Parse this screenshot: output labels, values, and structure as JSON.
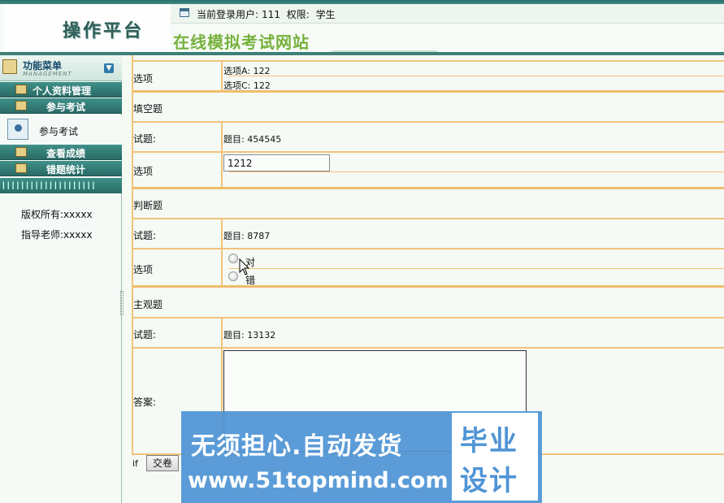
{
  "header": {
    "logo_title": "操作平台",
    "site_title": "在线模拟考试网站",
    "current_user_label": "当前登录用户:",
    "current_user": "111",
    "role_label": "权限:",
    "role": "学生"
  },
  "sidebar": {
    "menu_title": "功能菜单",
    "menu_subtitle": "MANAGEMENT",
    "items": [
      {
        "label": "个人资料管理"
      },
      {
        "label": "参与考试"
      },
      {
        "label": "查看成绩"
      },
      {
        "label": "错题统计"
      }
    ],
    "active_sub": "参与考试",
    "copyright": "版权所有:xxxxx",
    "teacher": "指导老师:xxxxx"
  },
  "exam": {
    "choice": {
      "options_label": "选项",
      "option_a": "选项A: 122",
      "option_c": "选项C: 122"
    },
    "fill": {
      "section": "填空题",
      "question_label": "试题:",
      "question": "题目: 454545",
      "options_label": "选项",
      "answer": "1212"
    },
    "judge": {
      "section": "判断题",
      "question_label": "试题:",
      "question": "题目: 8787",
      "options_label": "选项",
      "option_true": "对",
      "option_false": "错"
    },
    "subjective": {
      "section": "主观题",
      "question_label": "试题:",
      "question": "题目: 13132",
      "answer_label": "答案:"
    },
    "submit_prefix": "if",
    "submit_label": "交卷"
  },
  "watermark": {
    "slogan": "无须担心.自动发货",
    "url": "www.51topmind.com",
    "box_line1": "毕业",
    "box_line2": "设计"
  }
}
